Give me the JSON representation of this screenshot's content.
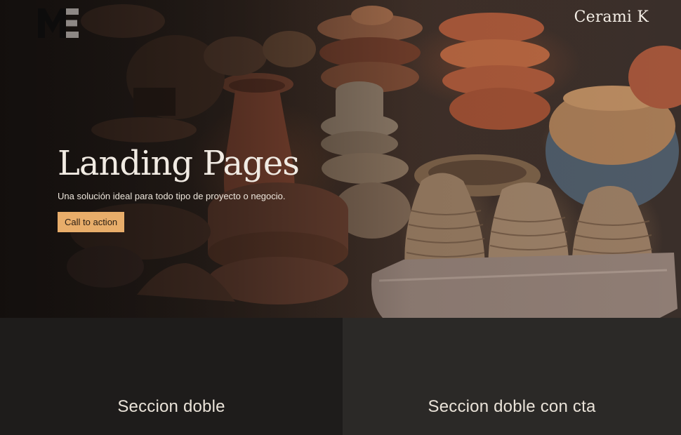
{
  "header": {
    "logo_text": "ME",
    "brand": "Cerami K"
  },
  "hero": {
    "title": "Landing Pages",
    "subtitle": "Una solución ideal para todo tipo de proyecto o negocio.",
    "cta_label": "Call to action",
    "cta_color": "#e8ad6a"
  },
  "sections": [
    {
      "title": "Seccion doble"
    },
    {
      "title": "Seccion doble con cta"
    }
  ]
}
